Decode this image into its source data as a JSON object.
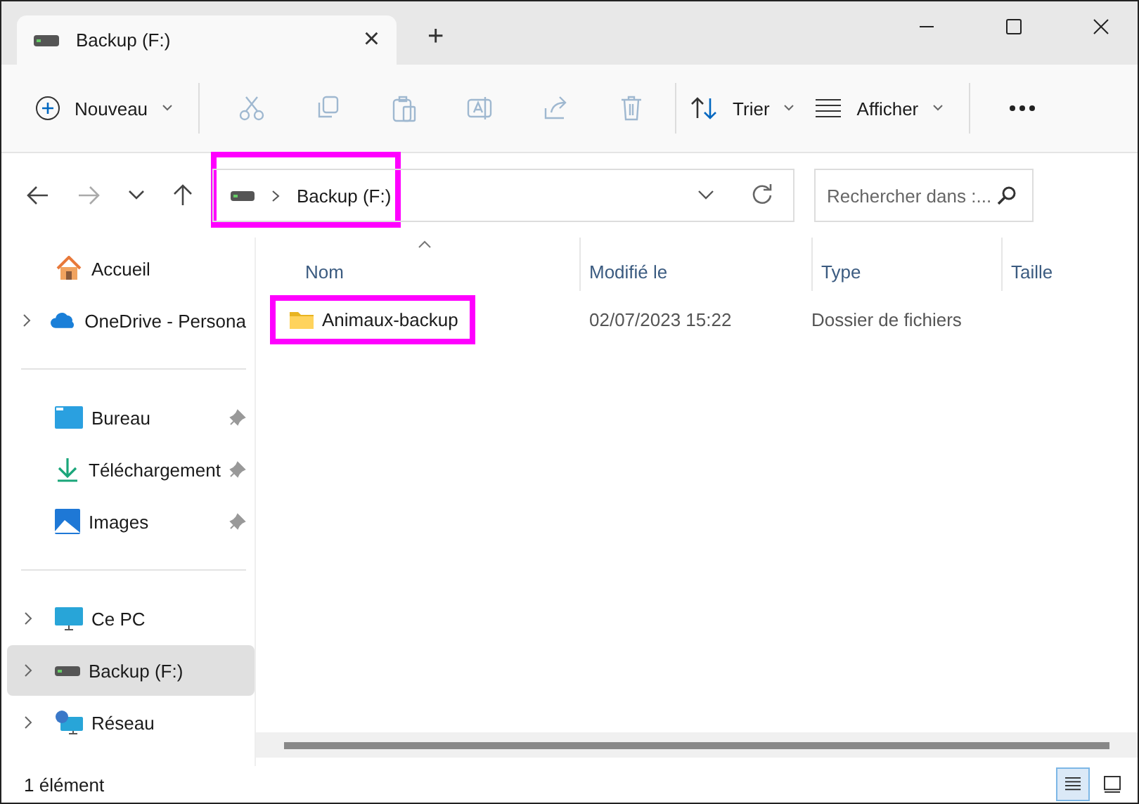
{
  "tab": {
    "title": "Backup (F:)",
    "close": "×",
    "new": "+"
  },
  "toolbar": [
    {
      "kind": "menu",
      "label": "Nouveau",
      "disabled": false
    },
    {
      "kind": "icon",
      "disabled": true
    },
    {
      "kind": "icon",
      "disabled": true
    },
    {
      "kind": "icon",
      "disabled": true
    },
    {
      "kind": "icon",
      "disabled": true
    },
    {
      "kind": "icon",
      "disabled": true
    },
    {
      "kind": "icon",
      "disabled": true
    },
    {
      "kind": "menu",
      "label": "Trier",
      "disabled": false
    },
    {
      "kind": "menu",
      "label": "Afficher",
      "disabled": false
    },
    {
      "kind": "more"
    }
  ],
  "address": {
    "crumb": "Backup (F:)",
    "highlighted": true
  },
  "search": {
    "placeholder": "Rechercher dans :..."
  },
  "sidebar": [
    [
      {
        "label": "Accueil",
        "expandable": false,
        "pinned": false,
        "selected": false
      },
      {
        "label": "OneDrive - Persona",
        "expandable": true,
        "pinned": false,
        "selected": false
      }
    ],
    [
      {
        "label": "Bureau",
        "expandable": false,
        "pinned": true,
        "selected": false
      },
      {
        "label": "Téléchargement",
        "expandable": false,
        "pinned": true,
        "selected": false
      },
      {
        "label": "Images",
        "expandable": false,
        "pinned": true,
        "selected": false
      }
    ],
    [
      {
        "label": "Ce PC",
        "expandable": true,
        "pinned": false,
        "selected": false
      },
      {
        "label": "Backup (F:)",
        "expandable": true,
        "pinned": false,
        "selected": true
      },
      {
        "label": "Réseau",
        "expandable": true,
        "pinned": false,
        "selected": false
      }
    ]
  ],
  "table": {
    "columns": [
      {
        "label": "Nom",
        "sorted": true
      },
      {
        "label": "Modifié le",
        "sorted": false
      },
      {
        "label": "Type",
        "sorted": false
      },
      {
        "label": "Taille",
        "sorted": false
      }
    ],
    "rows": [
      {
        "name": "Animaux-backup",
        "modified": "02/07/2023 15:22",
        "type": "Dossier de fichiers",
        "highlighted": true
      }
    ]
  },
  "status_bar": {
    "count": "1 élément",
    "views": [
      {
        "selected": true
      },
      {
        "selected": false
      }
    ]
  }
}
